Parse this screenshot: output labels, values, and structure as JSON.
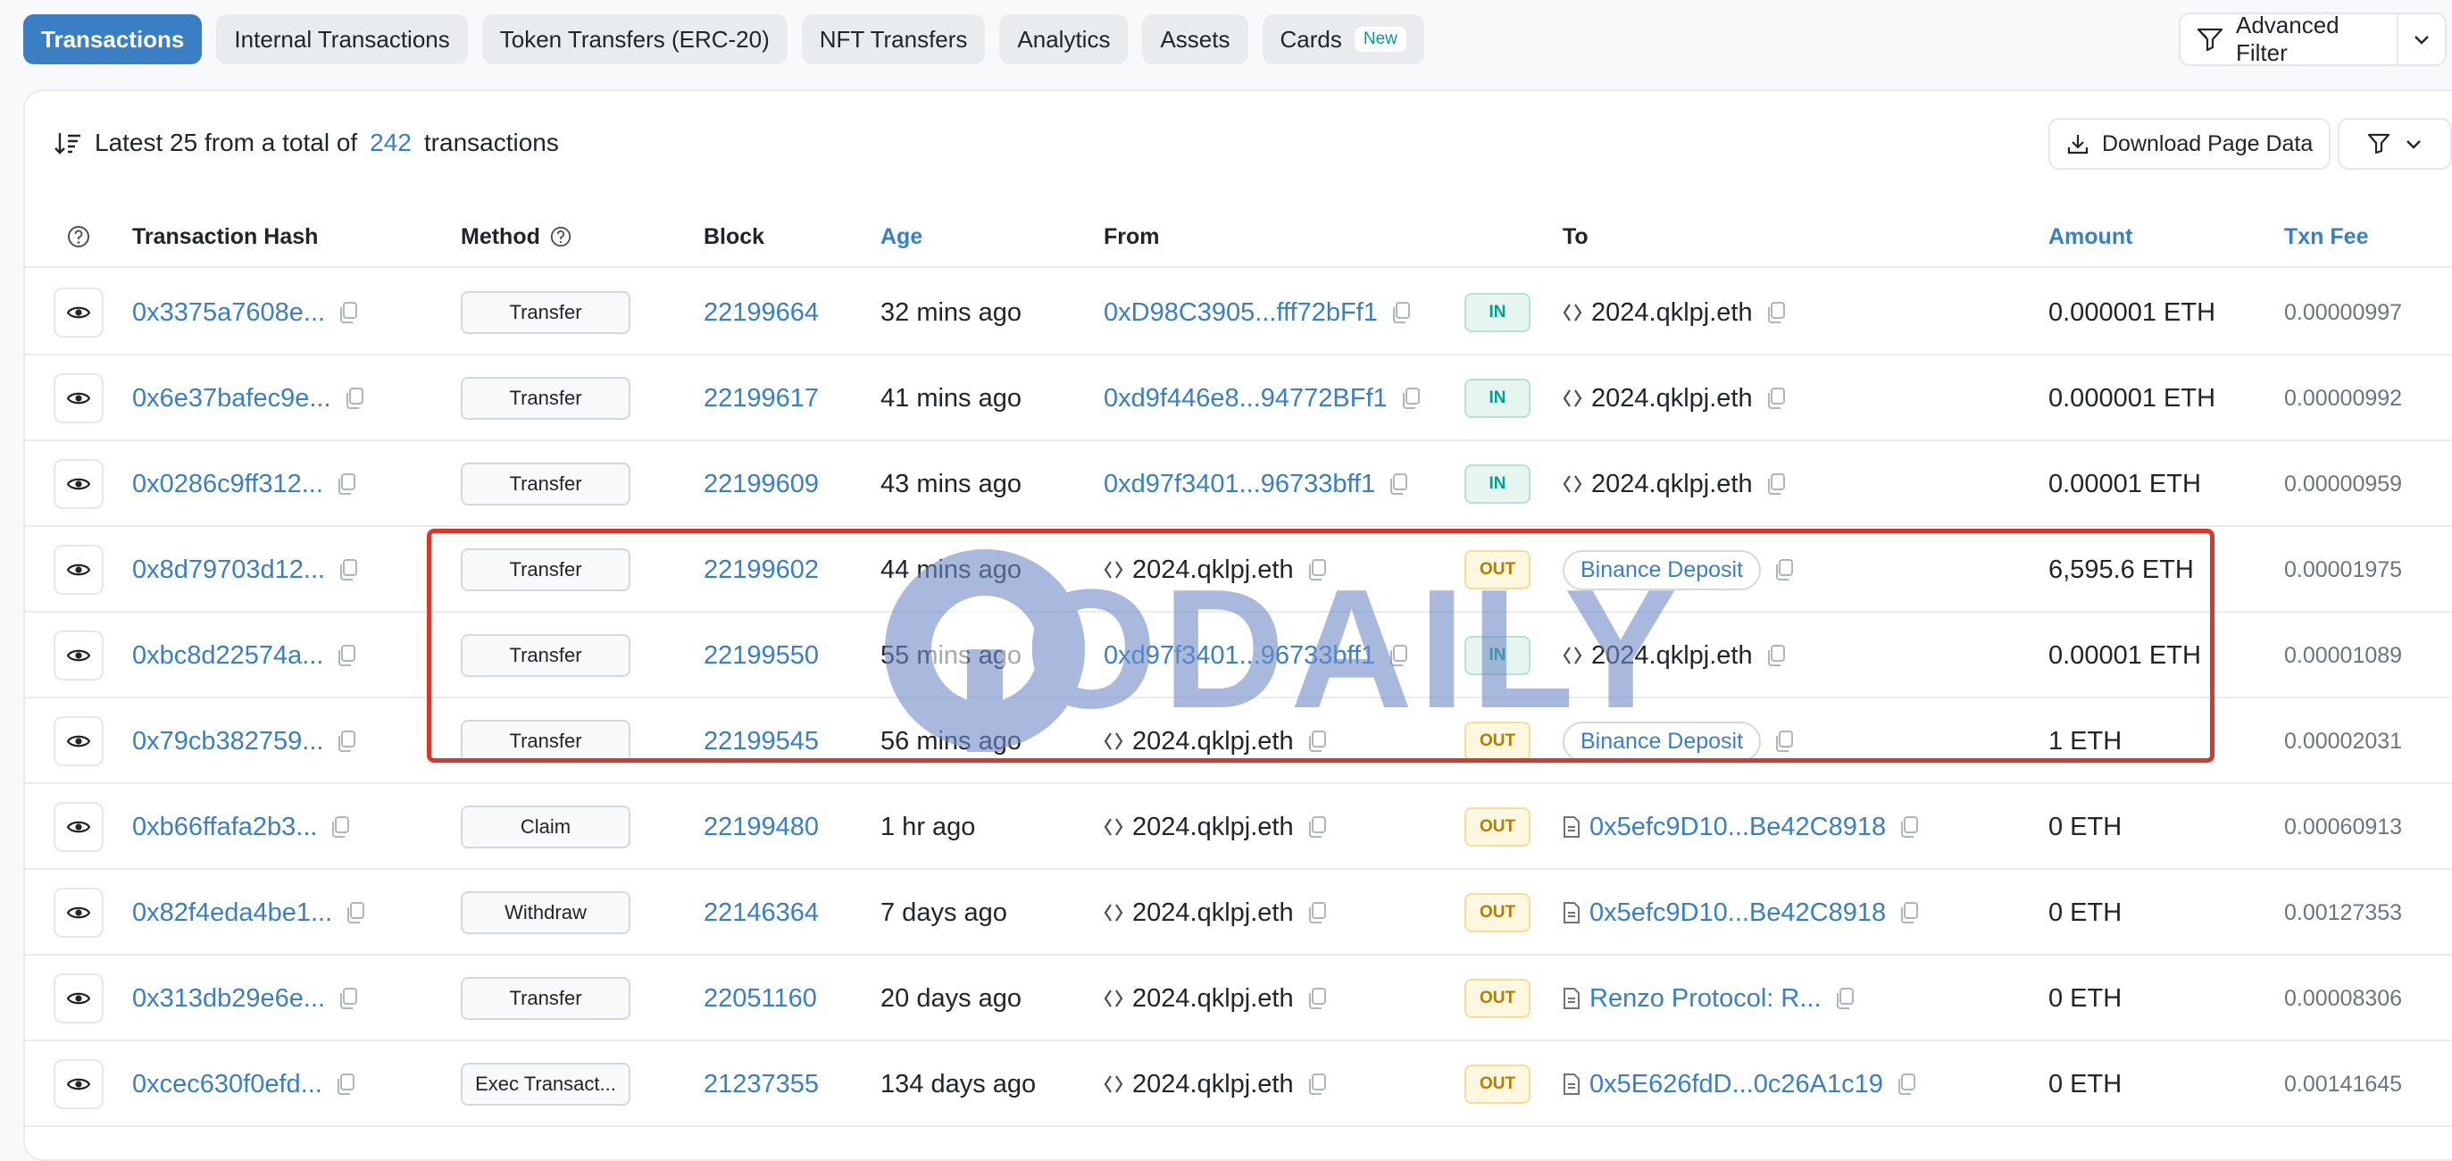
{
  "tabs": [
    {
      "label": "Transactions"
    },
    {
      "label": "Internal Transactions"
    },
    {
      "label": "Token Transfers (ERC-20)"
    },
    {
      "label": "NFT Transfers"
    },
    {
      "label": "Analytics"
    },
    {
      "label": "Assets"
    },
    {
      "label": "Cards",
      "badge": "New"
    }
  ],
  "advanced_filter_label": "Advanced Filter",
  "summary": {
    "prefix": "Latest 25 from a total of",
    "count": "242",
    "suffix": "transactions"
  },
  "download_label": "Download Page Data",
  "columns": {
    "hash": "Transaction Hash",
    "method": "Method",
    "block": "Block",
    "age": "Age",
    "from": "From",
    "to": "To",
    "amount": "Amount",
    "fee": "Txn Fee"
  },
  "rows": [
    {
      "hash": "0x3375a7608e...",
      "method": "Transfer",
      "block": "22199664",
      "age": "32 mins ago",
      "from": "0xD98C3905...fff72bFf1",
      "dir": "IN",
      "to": "2024.qklpj.eth",
      "amount": "0.000001 ETH",
      "fee": "0.00000997"
    },
    {
      "hash": "0x6e37bafec9e...",
      "method": "Transfer",
      "block": "22199617",
      "age": "41 mins ago",
      "from": "0xd9f446e8...94772BFf1",
      "dir": "IN",
      "to": "2024.qklpj.eth",
      "amount": "0.000001 ETH",
      "fee": "0.00000992"
    },
    {
      "hash": "0x0286c9ff312...",
      "method": "Transfer",
      "block": "22199609",
      "age": "43 mins ago",
      "from": "0xd97f3401...96733bff1",
      "dir": "IN",
      "to": "2024.qklpj.eth",
      "amount": "0.00001 ETH",
      "fee": "0.00000959"
    },
    {
      "hash": "0x8d79703d12...",
      "method": "Transfer",
      "block": "22199602",
      "age": "44 mins ago",
      "from": "2024.qklpj.eth",
      "dir": "OUT",
      "to": "Binance Deposit",
      "amount": "6,595.6 ETH",
      "fee": "0.00001975"
    },
    {
      "hash": "0xbc8d22574a...",
      "method": "Transfer",
      "block": "22199550",
      "age": "55 mins ago",
      "from": "0xd97f3401...96733bff1",
      "dir": "IN",
      "to": "2024.qklpj.eth",
      "amount": "0.00001 ETH",
      "fee": "0.00001089"
    },
    {
      "hash": "0x79cb382759...",
      "method": "Transfer",
      "block": "22199545",
      "age": "56 mins ago",
      "from": "2024.qklpj.eth",
      "dir": "OUT",
      "to": "Binance Deposit",
      "amount": "1 ETH",
      "fee": "0.00002031"
    },
    {
      "hash": "0xb66ffafa2b3...",
      "method": "Claim",
      "block": "22199480",
      "age": "1 hr ago",
      "from": "2024.qklpj.eth",
      "dir": "OUT",
      "to": "0x5efc9D10...Be42C8918",
      "amount": "0 ETH",
      "fee": "0.00060913"
    },
    {
      "hash": "0x82f4eda4be1...",
      "method": "Withdraw",
      "block": "22146364",
      "age": "7 days ago",
      "from": "2024.qklpj.eth",
      "dir": "OUT",
      "to": "0x5efc9D10...Be42C8918",
      "amount": "0 ETH",
      "fee": "0.00127353"
    },
    {
      "hash": "0x313db29e6e...",
      "method": "Transfer",
      "block": "22051160",
      "age": "20 days ago",
      "from": "2024.qklpj.eth",
      "dir": "OUT",
      "to": "Renzo Protocol: R...",
      "amount": "0 ETH",
      "fee": "0.00008306"
    },
    {
      "hash": "0xcec630f0efd...",
      "method": "Exec Transact...",
      "block": "21237355",
      "age": "134 days ago",
      "from": "2024.qklpj.eth",
      "dir": "OUT",
      "to": "0x5E626fdD...0c26A1c19",
      "amount": "0 ETH",
      "fee": "0.00141645"
    }
  ],
  "watermark": "ODAILY",
  "colors": {
    "accent": "#3a7fc3",
    "highlight": "#d9372b",
    "in": "#00a186",
    "out": "#b47d00"
  }
}
